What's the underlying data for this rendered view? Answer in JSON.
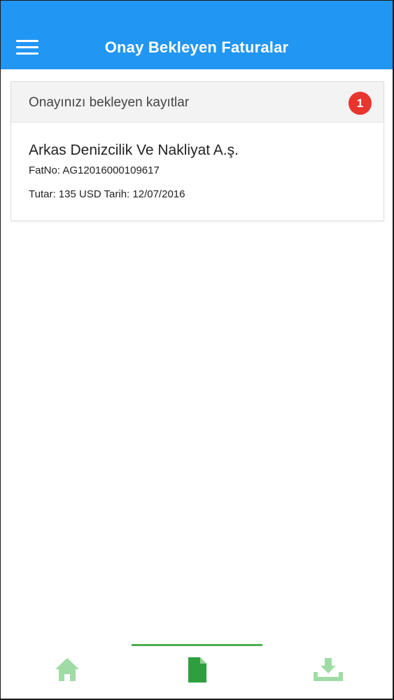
{
  "app_bar": {
    "title": "Onay Bekleyen Faturalar",
    "menu_icon": "hamburger-menu-icon",
    "color": "#2196f3"
  },
  "pending_card": {
    "header_label": "Onayınızı bekleyen kayıtlar",
    "badge_count": "1",
    "badge_color": "#e8352e",
    "records": [
      {
        "company": "Arkas Denizcilik Ve Nakliyat A.ş.",
        "fat_no": "FatNo: AG12016000109617",
        "amount_date": "Tutar: 135 USD Tarih: 12/07/2016"
      }
    ]
  },
  "bottom_nav": {
    "active_tab": "invoices",
    "active_color": "#2e9e3e",
    "inactive_color": "#9fdca5",
    "tabs": [
      {
        "id": "home",
        "icon": "home-icon"
      },
      {
        "id": "invoices",
        "icon": "document-icon"
      },
      {
        "id": "download",
        "icon": "download-tray-icon"
      }
    ]
  }
}
